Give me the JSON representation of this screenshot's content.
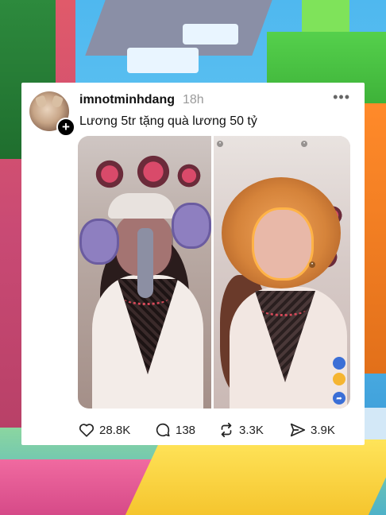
{
  "post": {
    "username": "imnotminhdang",
    "time": "18h",
    "more_icon": "more-horizontal-icon",
    "caption": "Lương 5tr tặng quà lương 50 tỷ"
  },
  "stats": {
    "likes": "28.8K",
    "comments": "138",
    "reposts": "3.3K",
    "shares": "3.9K"
  },
  "colors": {
    "card_bg": "#ffffff",
    "text": "#111111",
    "muted": "#9a9a9a"
  }
}
